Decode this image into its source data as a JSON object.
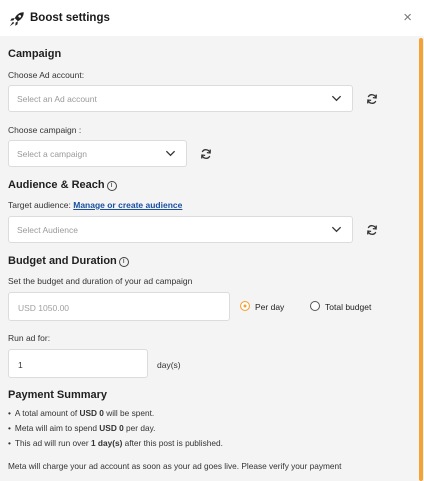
{
  "dialog": {
    "title": "Boost settings",
    "close_glyph": "×",
    "logo_icon": "rocket-icon",
    "close_icon": "close-icon"
  },
  "colors": {
    "accent": "#f3a233",
    "link": "#1a4fa0",
    "panel_bg": "#f4f4f4"
  },
  "campaign": {
    "heading": "Campaign",
    "ad_account_label": "Choose Ad account:",
    "ad_account_placeholder": "Select an Ad account",
    "campaign_label": "Choose campaign :",
    "campaign_placeholder": "Select a campaign"
  },
  "audience": {
    "heading": "Audience & Reach",
    "target_label": "Target audience:",
    "manage_link": "Manage or create audience",
    "placeholder": "Select Audience"
  },
  "budget": {
    "heading": "Budget and Duration",
    "description": "Set the budget and duration of your ad campaign",
    "amount_placeholder": "USD 1050.00",
    "options": [
      {
        "label": "Per day",
        "selected": true
      },
      {
        "label": "Total budget",
        "selected": false
      }
    ],
    "run_label": "Run ad for:",
    "run_value": "1",
    "run_unit": "day(s)"
  },
  "summary": {
    "heading": "Payment Summary",
    "line1_pre": "A total amount of ",
    "line1_bold": "USD 0",
    "line1_post": " will be spent.",
    "line2_pre": "Meta will aim to spend ",
    "line2_bold": "USD 0",
    "line2_post": " per day.",
    "line3_pre": "This ad will run over ",
    "line3_bold": "1 day(s)",
    "line3_post": " after this post is published.",
    "footer": "Meta will charge your ad account as soon as your ad goes live. Please verify your payment"
  }
}
